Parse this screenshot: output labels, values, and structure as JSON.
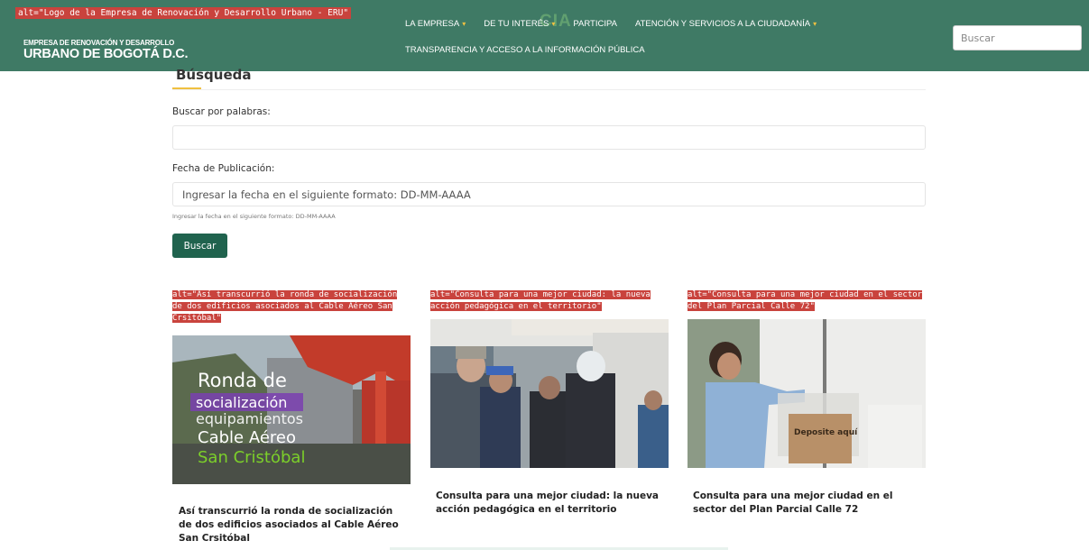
{
  "header": {
    "logo_alt": "alt=\"Logo de la Empresa de Renovación y Desarrollo Urbano - ERU\"",
    "logo_line1": "EMPRESA DE RENOVACIÓN Y DESARROLLO",
    "logo_line2": "URBANO DE BOGOTÁ D.C.",
    "nav_row1": [
      {
        "label": "LA EMPRESA",
        "caret": "▾"
      },
      {
        "label": "DE TU INTERÉS",
        "caret": "▾"
      },
      {
        "label": "PARTICIPA",
        "caret": ""
      },
      {
        "label": "ATENCIÓN Y SERVICIOS A LA CIUDADANÍA",
        "caret": "▾"
      }
    ],
    "nav_row2": [
      {
        "label": "TRANSPARENCIA Y ACCESO A LA INFORMACIÓN PÚBLICA"
      }
    ],
    "search_placeholder": "Buscar"
  },
  "search": {
    "title": "Búsqueda",
    "words_label": "Buscar por palabras:",
    "words_value": "",
    "date_label": "Fecha de Publicación:",
    "date_placeholder": "Ingresar la fecha en el siguiente formato: DD-MM-AAAA",
    "date_hint": "Ingresar la fecha en el siguiente formato: DD-MM-AAAA",
    "button": "Buscar"
  },
  "cards": [
    {
      "alt": "alt=\"Así transcurrió la ronda de socialización de dos edificios asociados al Cable Aéreo San Crsitóbal\"",
      "title": "Así transcurrió la ronda de socialización de dos edificios asociados al Cable Aéreo San Crsitóbal",
      "image_text": [
        "Ronda de",
        "socialización",
        "equipamientos",
        "Cable Aéreo",
        "San Cristóbal"
      ]
    },
    {
      "alt": "alt=\"Consulta para una mejor ciudad: la nueva acción pedagógica en el territorio\"",
      "title": "Consulta para una mejor ciudad: la nueva acción pedagógica en el territorio"
    },
    {
      "alt": "alt=\"Consulta para una mejor ciudad en el sector del Plan Parcial Calle 72\"",
      "title": "Consulta para una mejor ciudad en el sector del Plan Parcial Calle 72",
      "image_text": [
        "Deposite aquí"
      ]
    }
  ],
  "colors": {
    "header_bg": "#3f7a65",
    "button_bg": "#20634e",
    "accent": "#f0c040",
    "alt_tag_bg": "#c9433d"
  }
}
